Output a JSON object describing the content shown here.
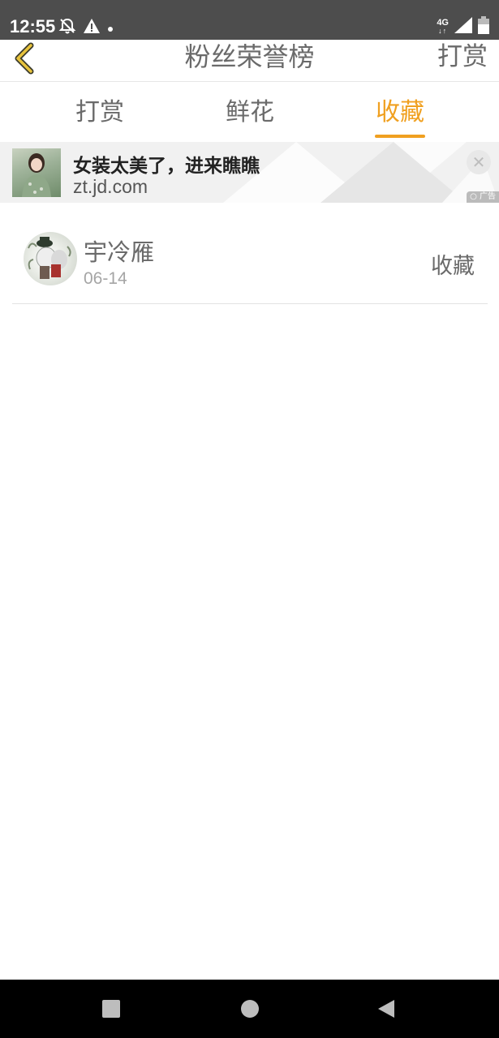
{
  "status_bar": {
    "time": "12:55",
    "network": "4G",
    "icons": [
      "notifications-off-icon",
      "alert-icon",
      "dot-icon",
      "signal-icon",
      "battery-icon"
    ]
  },
  "header": {
    "title": "粉丝荣誉榜",
    "action_label": "打赏",
    "back_icon": "chevron-left-icon"
  },
  "tabs": [
    {
      "label": "打赏",
      "active": false
    },
    {
      "label": "鲜花",
      "active": false
    },
    {
      "label": "收藏",
      "active": true
    }
  ],
  "ad": {
    "title": "女装太美了，进来瞧瞧",
    "url": "zt.jd.com",
    "badge": "广告",
    "close_icon": "close-icon"
  },
  "list": [
    {
      "name": "宇冷雁",
      "date": "06-14",
      "type": "收藏"
    }
  ],
  "colors": {
    "accent": "#f0a020",
    "text_primary": "#6a6a6a",
    "text_secondary": "#a5a5a5",
    "status_bar_bg": "#4d4d4d",
    "nav_bar_bg": "#000000"
  },
  "nav_bar": {
    "icons": [
      "square-recents-icon",
      "circle-home-icon",
      "triangle-back-icon"
    ]
  }
}
